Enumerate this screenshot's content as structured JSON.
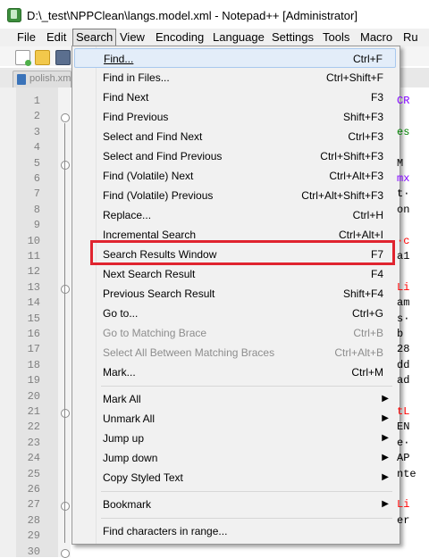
{
  "window": {
    "title": "D:\\_test\\NPPClean\\langs.model.xml - Notepad++ [Administrator]"
  },
  "menubar": {
    "items": [
      "File",
      "Edit",
      "Search",
      "View",
      "Encoding",
      "Language",
      "Settings",
      "Tools",
      "Macro",
      "Ru"
    ]
  },
  "tab": {
    "label": "polish.xml"
  },
  "editor": {
    "line_numbers": [
      "1",
      "2",
      "3",
      "4",
      "5",
      "6",
      "7",
      "8",
      "9",
      "10",
      "11",
      "12",
      "13",
      "14",
      "15",
      "16",
      "17",
      "18",
      "19",
      "20",
      "21",
      "22",
      "23",
      "24",
      "25",
      "26",
      "27",
      "28",
      "29",
      "30"
    ],
    "visible_fragments": [
      "CR",
      "es",
      "M",
      "mx",
      "t·",
      "on",
      "·c",
      "a1",
      "Li",
      "am",
      "s·",
      "b",
      "28",
      "dd",
      "ad",
      "tL",
      "EN",
      "e·",
      "AP",
      "nte",
      "Li",
      "er"
    ]
  },
  "search_menu": {
    "items": [
      {
        "label": "Find...",
        "shortcut": "Ctrl+F"
      },
      {
        "label": "Find in Files...",
        "shortcut": "Ctrl+Shift+F"
      },
      {
        "label": "Find Next",
        "shortcut": "F3"
      },
      {
        "label": "Find Previous",
        "shortcut": "Shift+F3"
      },
      {
        "label": "Select and Find Next",
        "shortcut": "Ctrl+F3"
      },
      {
        "label": "Select and Find Previous",
        "shortcut": "Ctrl+Shift+F3"
      },
      {
        "label": "Find (Volatile) Next",
        "shortcut": "Ctrl+Alt+F3"
      },
      {
        "label": "Find (Volatile) Previous",
        "shortcut": "Ctrl+Alt+Shift+F3"
      },
      {
        "label": "Replace...",
        "shortcut": "Ctrl+H"
      },
      {
        "label": "Incremental Search",
        "shortcut": "Ctrl+Alt+I"
      },
      {
        "label": "Search Results Window",
        "shortcut": "F7"
      },
      {
        "label": "Next Search Result",
        "shortcut": "F4"
      },
      {
        "label": "Previous Search Result",
        "shortcut": "Shift+F4"
      },
      {
        "label": "Go to...",
        "shortcut": "Ctrl+G"
      },
      {
        "label": "Go to Matching Brace",
        "shortcut": "Ctrl+B"
      },
      {
        "label": "Select All Between Matching Braces",
        "shortcut": "Ctrl+Alt+B"
      },
      {
        "label": "Mark...",
        "shortcut": "Ctrl+M"
      },
      {
        "label": "Mark All",
        "shortcut": ""
      },
      {
        "label": "Unmark All",
        "shortcut": ""
      },
      {
        "label": "Jump up",
        "shortcut": ""
      },
      {
        "label": "Jump down",
        "shortcut": ""
      },
      {
        "label": "Copy Styled Text",
        "shortcut": ""
      },
      {
        "label": "Bookmark",
        "shortcut": ""
      },
      {
        "label": "Find characters in range...",
        "shortcut": ""
      }
    ]
  },
  "colors": {
    "highlight_border": "#e0242f",
    "hover_bg": "#e3edf9"
  },
  "icons": [
    "app-icon",
    "new-file-icon",
    "open-file-icon",
    "save-icon",
    "submenu-arrow-icon",
    "fold-marker-icon"
  ]
}
